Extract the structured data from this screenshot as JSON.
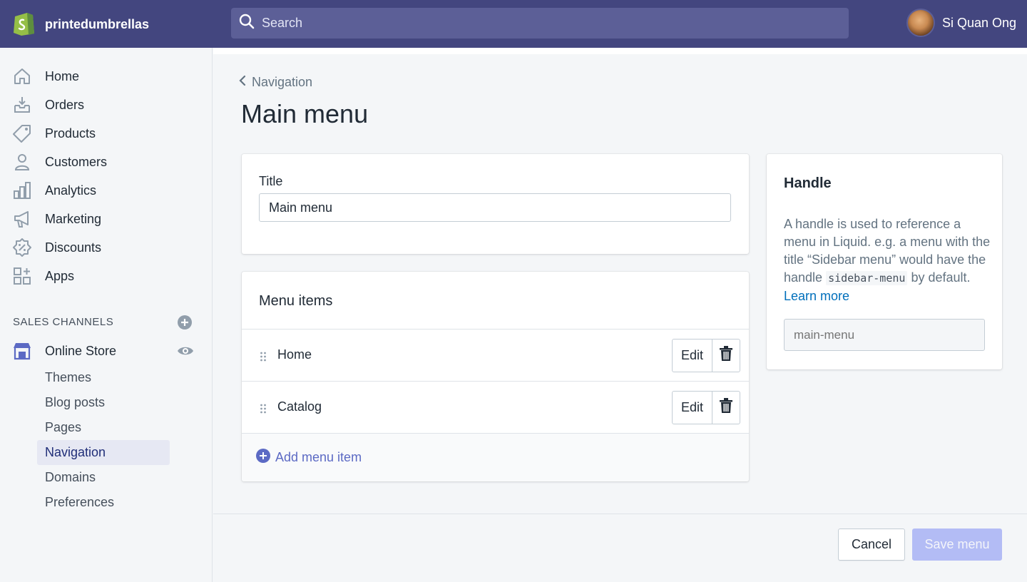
{
  "topbar": {
    "store_name": "printedumbrellas",
    "search_placeholder": "Search",
    "user_name": "Si Quan Ong",
    "bg_color": "#43467f"
  },
  "sidebar": {
    "items": [
      {
        "label": "Home",
        "icon": "home-icon"
      },
      {
        "label": "Orders",
        "icon": "orders-icon"
      },
      {
        "label": "Products",
        "icon": "tag-icon"
      },
      {
        "label": "Customers",
        "icon": "person-icon"
      },
      {
        "label": "Analytics",
        "icon": "bar-chart-icon"
      },
      {
        "label": "Marketing",
        "icon": "megaphone-icon"
      },
      {
        "label": "Discounts",
        "icon": "discount-icon"
      },
      {
        "label": "Apps",
        "icon": "apps-icon"
      }
    ],
    "sales_channels_title": "SALES CHANNELS",
    "online_store_label": "Online Store",
    "sub_items": [
      {
        "label": "Themes"
      },
      {
        "label": "Blog posts"
      },
      {
        "label": "Pages"
      },
      {
        "label": "Navigation",
        "active": true
      },
      {
        "label": "Domains"
      },
      {
        "label": "Preferences"
      }
    ]
  },
  "main": {
    "breadcrumb": "Navigation",
    "page_title": "Main menu",
    "title_card": {
      "label": "Title",
      "value": "Main menu"
    },
    "menu_card": {
      "heading": "Menu items",
      "rows": [
        {
          "label": "Home",
          "edit_label": "Edit"
        },
        {
          "label": "Catalog",
          "edit_label": "Edit"
        }
      ],
      "add_label": "Add menu item"
    },
    "handle_card": {
      "heading": "Handle",
      "desc_part1": "A handle is used to reference a menu in Liquid. e.g. a menu with the title “Sidebar menu” would have the handle ",
      "desc_code": "sidebar-menu",
      "desc_part2": " by default. ",
      "learn_more": "Learn more",
      "placeholder": "main-menu"
    },
    "footer": {
      "cancel_label": "Cancel",
      "save_label": "Save menu"
    }
  },
  "colors": {
    "accent": "#5c6ac4",
    "link": "#006fbb",
    "save_disabled": "#b3bcf5"
  }
}
